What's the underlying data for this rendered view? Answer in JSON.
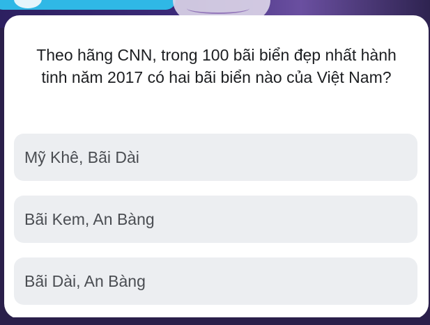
{
  "quiz": {
    "question": "Theo hãng CNN, trong 100 bãi biển đẹp nhất hành tinh năm 2017 có hai bãi biển nào của Việt Nam?",
    "answers": [
      {
        "label": "Mỹ Khê, Bãi Dài"
      },
      {
        "label": "Bãi Kem, An Bàng"
      },
      {
        "label": "Bãi Dài, An Bàng"
      }
    ]
  },
  "colors": {
    "card_background": "#ffffff",
    "answer_background": "#eceef1",
    "question_text": "#1c1e21",
    "answer_text": "#4a4d52",
    "accent_pill": "#2fb8e6"
  }
}
